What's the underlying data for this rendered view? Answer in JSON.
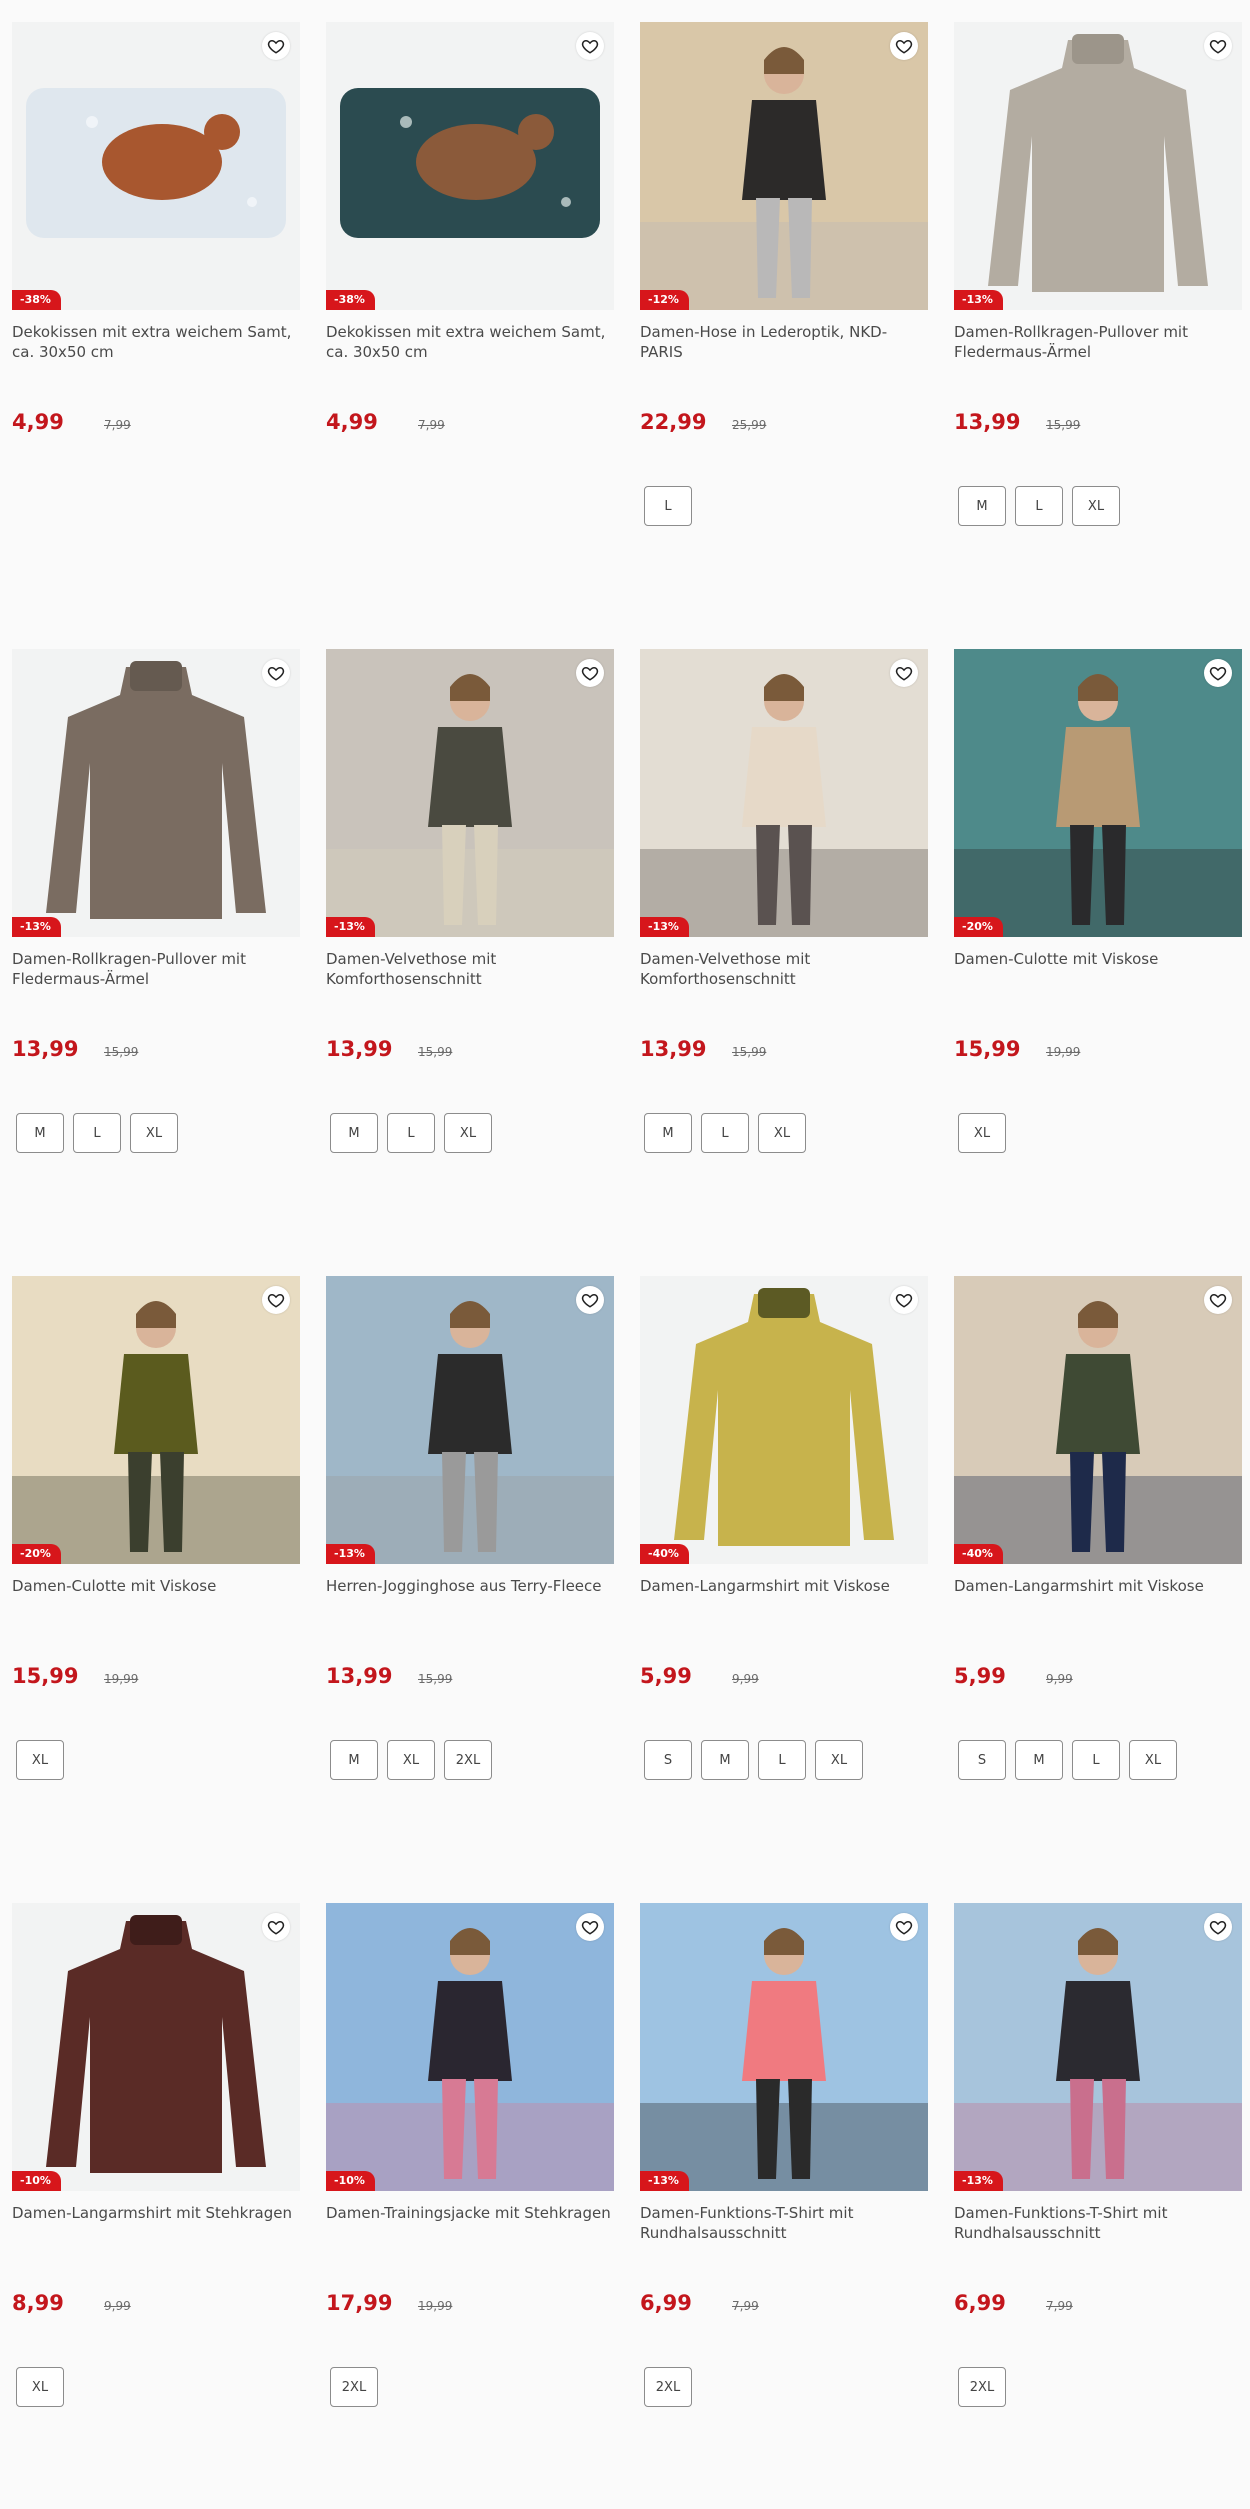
{
  "products": [
    {
      "title": "Dekokissen mit extra weichem Samt, ca. 30x50 cm",
      "discount": "-38%",
      "price": "4,99",
      "old_price": "7,99",
      "sizes": [],
      "image": "pillow-horse",
      "colors": {
        "bg": "#dfe7ee",
        "main": "#a8572f",
        "accent": "#f4f7fa"
      }
    },
    {
      "title": "Dekokissen mit extra weichem Samt, ca. 30x50 cm",
      "discount": "-38%",
      "price": "4,99",
      "old_price": "7,99",
      "sizes": [],
      "image": "pillow-deer",
      "colors": {
        "bg": "#2b4b50",
        "main": "#8b5a3a",
        "accent": "#c9d6d4"
      }
    },
    {
      "title": "Damen-Hose in Lederoptik, NKD-PARIS",
      "discount": "-12%",
      "price": "22,99",
      "old_price": "25,99",
      "sizes": [
        "L"
      ],
      "image": "model-stairs",
      "colors": {
        "bg": "#d9c7a8",
        "main": "#2c2a29",
        "accent": "#b9b8b8"
      }
    },
    {
      "title": "Damen-Rollkragen-Pullover mit Fledermaus-Ärmel",
      "discount": "-13%",
      "price": "13,99",
      "old_price": "15,99",
      "sizes": [
        "M",
        "L",
        "XL"
      ],
      "image": "sweater-beige",
      "colors": {
        "bg": "#f2f3f3",
        "main": "#b3aca1",
        "accent": "#9c958a"
      }
    },
    {
      "title": "Damen-Rollkragen-Pullover mit Fledermaus-Ärmel",
      "discount": "-13%",
      "price": "13,99",
      "old_price": "15,99",
      "sizes": [
        "M",
        "L",
        "XL"
      ],
      "image": "sweater-brown",
      "colors": {
        "bg": "#f2f3f3",
        "main": "#7a6c61",
        "accent": "#655a50"
      }
    },
    {
      "title": "Damen-Velvethose mit Komforthosenschnitt",
      "discount": "-13%",
      "price": "13,99",
      "old_price": "15,99",
      "sizes": [
        "M",
        "L",
        "XL"
      ],
      "image": "model-street",
      "colors": {
        "bg": "#c9c3bb",
        "main": "#4a4a40",
        "accent": "#d8d0bc"
      }
    },
    {
      "title": "Damen-Velvethose mit Komforthosenschnitt",
      "discount": "-13%",
      "price": "13,99",
      "old_price": "15,99",
      "sizes": [
        "M",
        "L",
        "XL"
      ],
      "image": "model-sofa-light",
      "colors": {
        "bg": "#e3ddd3",
        "main": "#e6d9c8",
        "accent": "#5a5250"
      }
    },
    {
      "title": "Damen-Culotte mit Viskose",
      "discount": "-20%",
      "price": "15,99",
      "old_price": "19,99",
      "sizes": [
        "XL"
      ],
      "image": "model-sofa-teal",
      "colors": {
        "bg": "#4e8a8a",
        "main": "#b89a74",
        "accent": "#2a2a2c"
      }
    },
    {
      "title": "Damen-Culotte mit Viskose",
      "discount": "-20%",
      "price": "15,99",
      "old_price": "19,99",
      "sizes": [
        "XL"
      ],
      "image": "model-olive",
      "colors": {
        "bg": "#e8dcc2",
        "main": "#5b5b1e",
        "accent": "#3b3f2e"
      }
    },
    {
      "title": "Herren-Jogginghose aus Terry-Fleece",
      "discount": "-13%",
      "price": "13,99",
      "old_price": "15,99",
      "sizes": [
        "M",
        "XL",
        "2XL"
      ],
      "image": "model-jogger",
      "colors": {
        "bg": "#9fb7c8",
        "main": "#2b2b2b",
        "accent": "#9a9a9a"
      }
    },
    {
      "title": "Damen-Langarmshirt mit Viskose",
      "discount": "-40%",
      "price": "5,99",
      "old_price": "9,99",
      "sizes": [
        "S",
        "M",
        "L",
        "XL"
      ],
      "image": "shirt-zebra",
      "colors": {
        "bg": "#f2f3f3",
        "main": "#c7b34c",
        "accent": "#5c5a24"
      }
    },
    {
      "title": "Damen-Langarmshirt mit Viskose",
      "discount": "-40%",
      "price": "5,99",
      "old_price": "9,99",
      "sizes": [
        "S",
        "M",
        "L",
        "XL"
      ],
      "image": "model-green-shirt",
      "colors": {
        "bg": "#d8cbb8",
        "main": "#3f4a34",
        "accent": "#1e2a4a"
      }
    },
    {
      "title": "Damen-Langarmshirt mit Stehkragen",
      "discount": "-10%",
      "price": "8,99",
      "old_price": "9,99",
      "sizes": [
        "XL"
      ],
      "image": "shirt-maroon",
      "colors": {
        "bg": "#f2f3f3",
        "main": "#5a2b26",
        "accent": "#3f1d1a"
      }
    },
    {
      "title": "Damen-Trainingsjacke mit Stehkragen",
      "discount": "-10%",
      "price": "17,99",
      "old_price": "19,99",
      "sizes": [
        "2XL"
      ],
      "image": "model-jacket",
      "colors": {
        "bg": "#8fb6dc",
        "main": "#2a2630",
        "accent": "#d77a94"
      }
    },
    {
      "title": "Damen-Funktions-T-Shirt mit Rundhalsausschnitt",
      "discount": "-13%",
      "price": "6,99",
      "old_price": "7,99",
      "sizes": [
        "2XL"
      ],
      "image": "model-pink-shirt",
      "colors": {
        "bg": "#9ec3e2",
        "main": "#f07a80",
        "accent": "#2a2a2a"
      }
    },
    {
      "title": "Damen-Funktions-T-Shirt mit Rundhalsausschnitt",
      "discount": "-13%",
      "price": "6,99",
      "old_price": "7,99",
      "sizes": [
        "2XL"
      ],
      "image": "model-floral-shirt",
      "colors": {
        "bg": "#a7c4dc",
        "main": "#2b2a30",
        "accent": "#c96f8d"
      }
    }
  ]
}
